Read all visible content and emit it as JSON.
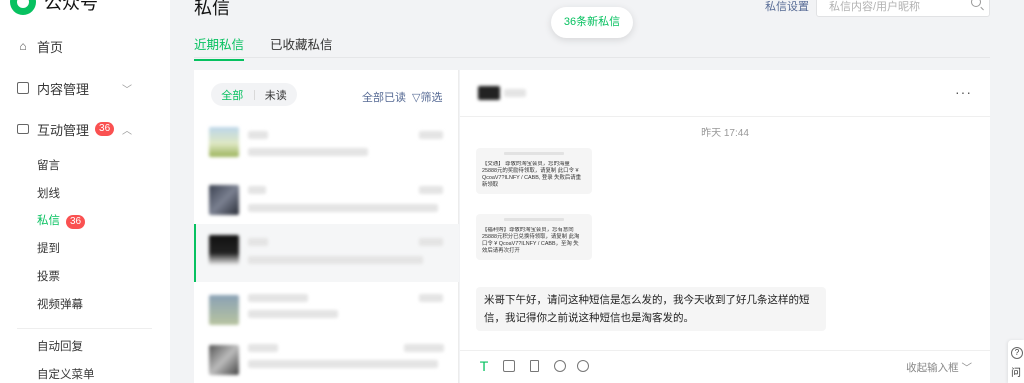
{
  "app": {
    "name": "公众号"
  },
  "sidebar": {
    "home": "首页",
    "content": "内容管理",
    "interaction": "互动管理",
    "interaction_badge": "36",
    "sub_items": [
      {
        "label": "留言"
      },
      {
        "label": "划线"
      },
      {
        "label": "私信",
        "badge": "36"
      },
      {
        "label": "提到"
      },
      {
        "label": "投票"
      },
      {
        "label": "视频弹幕"
      }
    ],
    "auto_reply": "自动回复",
    "custom_menu": "自定义菜单"
  },
  "header": {
    "title": "私信",
    "tabs": [
      {
        "label": "近期私信"
      },
      {
        "label": "已收藏私信"
      }
    ],
    "toast": "36条新私信",
    "settings": "私信设置",
    "search_placeholder": "私信内容/用户昵称"
  },
  "list": {
    "filter_all": "全部",
    "filter_unread": "未读",
    "mark_all_read": "全部已读",
    "filter": "筛选"
  },
  "chat": {
    "time": "昨天 17:44",
    "sms1": "【交通】 尊敬的淘宝会员，您的海量 25888元的奖励待领取，请复制 此口令 ¥ QcoaV7?ILNFY / CABB, 登录 失败后请重新领取",
    "sms2": "【福利购】尊敬的淘宝会员，您有意向 25888元积分已兑换待领取，请复制 此淘口令 ¥ QcoaV7?ILNFY / CABB，至淘 失效后请再次打开",
    "message": "米哥下午好，请问这种短信是怎么发的，我今天收到了好几条这样的短信，我记得你之前说这种短信也是淘客发的。",
    "collapse": "收起输入框",
    "text_tool": "T"
  },
  "help": {
    "label": "问"
  },
  "colors": {
    "accent": "#07c160",
    "link": "#576b95",
    "badge": "#fa5151"
  }
}
